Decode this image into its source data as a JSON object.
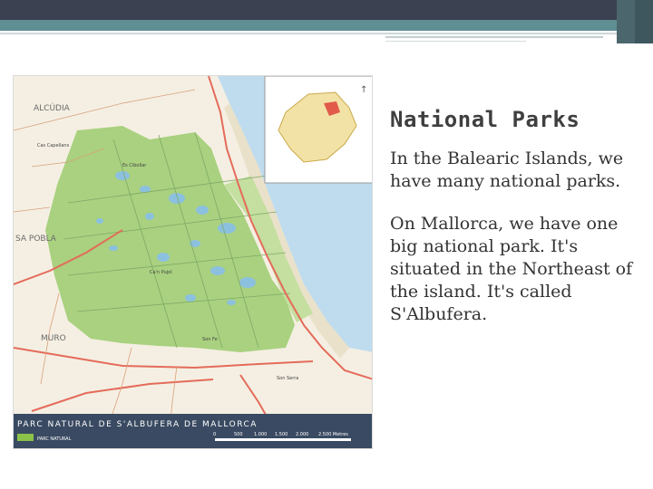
{
  "slide": {
    "title": "National Parks",
    "paragraphs": [
      "In  the Balearic Islands, we have many national parks.",
      "On Mallorca, we have one big national park. It's situated in the Northeast of the island. It's called S'Albufera."
    ]
  },
  "map": {
    "banner_text": "PARC NATURAL DE S'ALBUFERA DE MALLORCA",
    "legend_label": "PARC NATURAL",
    "scale_labels": [
      "0",
      "500",
      "1.000",
      "1.500",
      "2.000",
      "2.500 Metres"
    ],
    "place_labels": [
      "ALCÚDIA",
      "SA POBLA",
      "MURO",
      "Es Cibollar",
      "Ca'n Pujol",
      "Son Fe",
      "Cas Capellans",
      "Son Serra"
    ],
    "colors": {
      "park": "#a9d17f",
      "land": "#f5efe3",
      "sea": "#bfdcef",
      "road": "#e46b5a",
      "banner": "#3a4a62"
    }
  }
}
